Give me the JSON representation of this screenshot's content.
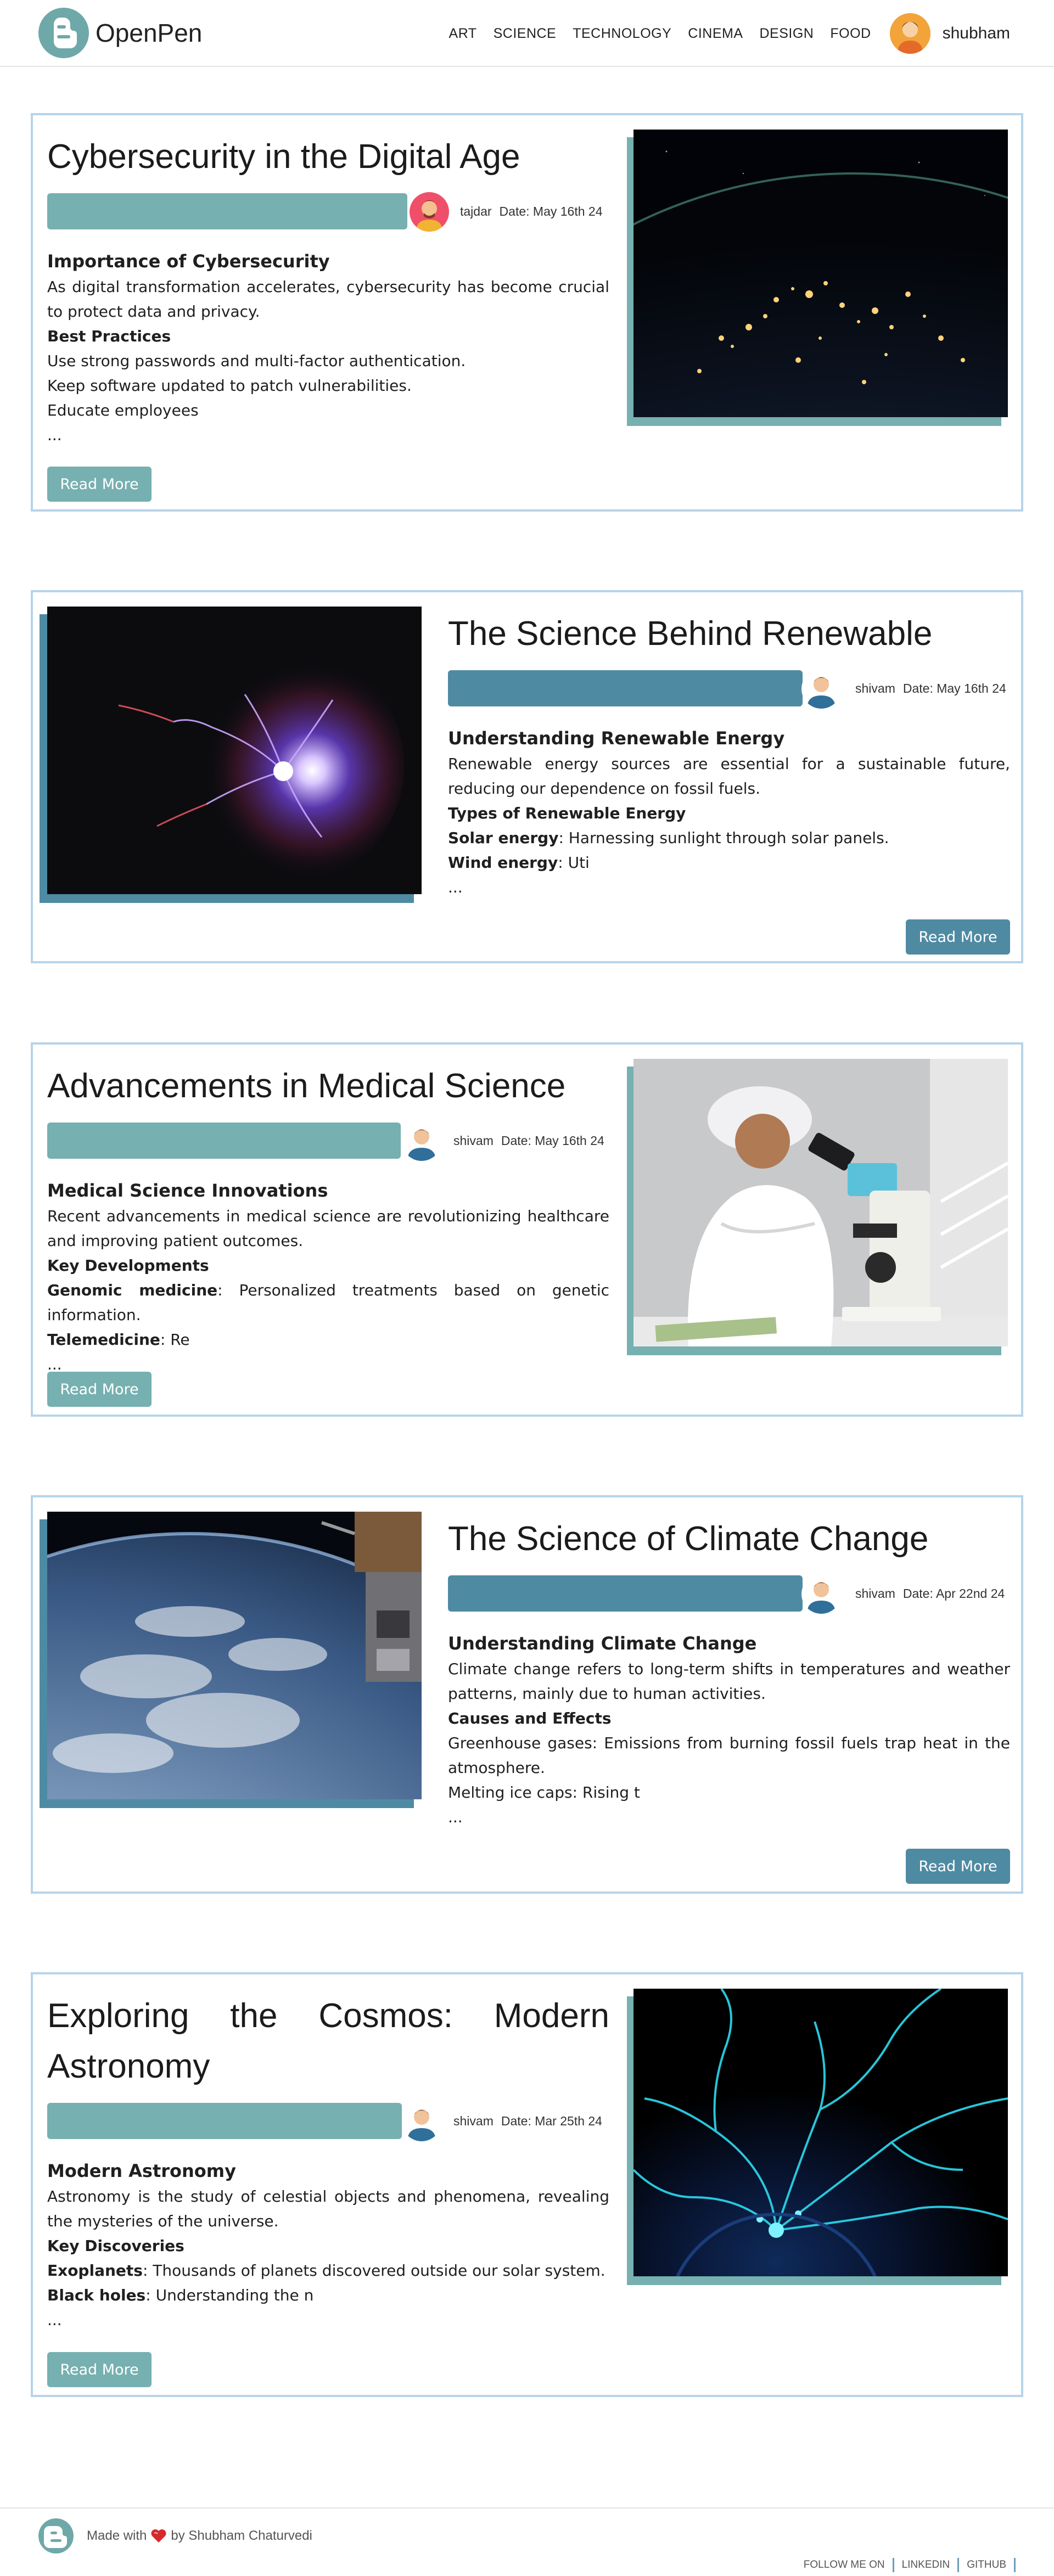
{
  "nav": {
    "brand": "OpenPen",
    "links": [
      "ART",
      "SCIENCE",
      "TECHNOLOGY",
      "CINEMA",
      "DESIGN",
      "FOOD"
    ],
    "username": "shubham"
  },
  "posts": [
    {
      "title": "Cybersecurity in the Digital Age",
      "author": "tajdar",
      "date": "Date: May 16th 24",
      "heading": "Importance of Cybersecurity",
      "intro": "As digital transformation accelerates, cybersecurity has become crucial to protect data and privacy.",
      "subheading": "Best Practices",
      "lines": [
        "Use strong passwords and multi-factor authentication.",
        "Keep software updated to patch vulnerabilities.",
        "Educate employees"
      ],
      "ellipsis": "...",
      "button": "Read More",
      "image": "earth-at-night-image"
    },
    {
      "title": "The Science Behind Renewable Energy",
      "author": "shivam",
      "date": "Date: May 16th 24",
      "heading": "Understanding Renewable Energy",
      "intro": "Renewable energy sources are essential for a sustainable future, reducing our dependence on fossil fuels.",
      "subheading": "Types of Renewable Energy",
      "items": [
        {
          "term": "Solar energy",
          "text": ": Harnessing sunlight through solar panels."
        },
        {
          "term": "Wind energy",
          "text": ": Uti"
        }
      ],
      "ellipsis": "...",
      "button": "Read More",
      "image": "plasma-ball-image"
    },
    {
      "title": "Advancements in Medical Science",
      "author": "shivam",
      "date": "Date: May 16th 24",
      "heading": "Medical Science Innovations",
      "intro": "Recent advancements in medical science are revolutionizing healthcare and improving patient outcomes.",
      "subheading": "Key Developments",
      "items": [
        {
          "term": "Genomic medicine",
          "text": ": Personalized treatments based on genetic information."
        },
        {
          "term": "Telemedicine",
          "text": ": Re"
        }
      ],
      "ellipsis": "...",
      "button": "Read More",
      "image": "microscope-scientist-image"
    },
    {
      "title": "The Science of Climate Change",
      "author": "shivam",
      "date": "Date: Apr 22nd 24",
      "heading": "Understanding Climate Change",
      "intro": "Climate change refers to long-term shifts in temperatures and weather patterns, mainly due to human activities.",
      "subheading": "Causes and Effects",
      "lines": [
        "Greenhouse gases: Emissions from burning fossil fuels trap heat in the atmosphere.",
        "Melting ice caps: Rising t"
      ],
      "ellipsis": "...",
      "button": "Read More",
      "image": "earth-from-orbit-image"
    },
    {
      "title": "Exploring the Cosmos: Modern Astronomy",
      "author": "shivam",
      "date": "Date: Mar 25th 24",
      "heading": "Modern Astronomy",
      "intro": "Astronomy is the study of celestial objects and phenomena, revealing the mysteries of the universe.",
      "subheading": "Key Discoveries",
      "items": [
        {
          "term": "Exoplanets",
          "text": ": Thousands of planets discovered outside our solar system."
        },
        {
          "term": "Black holes",
          "text": ": Understanding the n"
        }
      ],
      "ellipsis": "...",
      "button": "Read More",
      "image": "blue-plasma-image"
    }
  ],
  "footer": {
    "made_with": "Made with",
    "by": "by Shubham Chaturvedi",
    "links": [
      "FOLLOW ME ON",
      "LINKEDIN",
      "GITHUB"
    ]
  },
  "colors": {
    "teal": "#77b0b0",
    "steel_blue": "#4f8aa3",
    "card_border": "#b7d4ea",
    "brand": "#6fa8a8"
  }
}
